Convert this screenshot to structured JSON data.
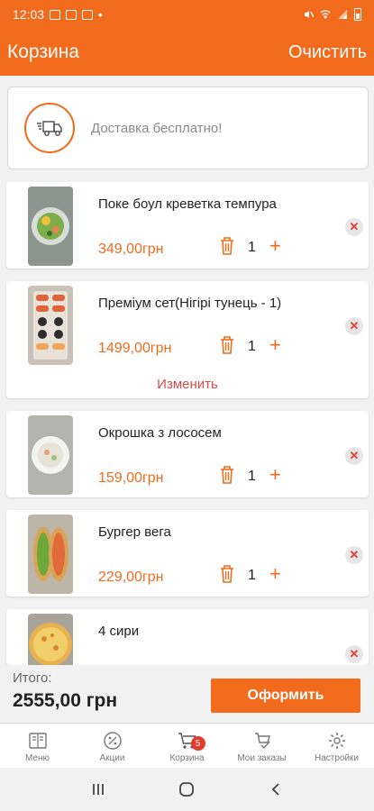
{
  "status_bar": {
    "time": "12:03",
    "dot": "•"
  },
  "app_bar": {
    "title": "Корзина",
    "clear_label": "Очистить"
  },
  "delivery": {
    "text": "Доставка бесплатно!",
    "icon": "truck-icon"
  },
  "cart_items": [
    {
      "name": "Поке боул креветка темпура",
      "price": "349,00грн",
      "qty": "1",
      "plus": "+",
      "remove": "✕"
    },
    {
      "name": "Преміум сет(Нігірі тунець - 1)",
      "price": "1499,00грн",
      "qty": "1",
      "plus": "+",
      "remove": "✕",
      "change_label": "Изменить"
    },
    {
      "name": "Окрошка з лососем",
      "price": "159,00грн",
      "qty": "1",
      "plus": "+",
      "remove": "✕"
    },
    {
      "name": "Бургер вега",
      "price": "229,00грн",
      "qty": "1",
      "plus": "+",
      "remove": "✕"
    },
    {
      "name": "4 сири",
      "remove": "✕"
    }
  ],
  "footer": {
    "total_label": "Итого:",
    "total_value": "2555,00 грн",
    "checkout_label": "Оформить"
  },
  "tabs": [
    {
      "label": "Меню",
      "icon": "menu-book-icon"
    },
    {
      "label": "Акции",
      "icon": "discount-icon"
    },
    {
      "label": "Корзина",
      "icon": "cart-icon",
      "badge": "5",
      "active": true
    },
    {
      "label": "Мои заказы",
      "icon": "orders-icon"
    },
    {
      "label": "Настройки",
      "icon": "gear-icon"
    }
  ],
  "colors": {
    "accent": "#f26b1d",
    "remove": "#e03a3a",
    "badge": "#e23a2e"
  }
}
